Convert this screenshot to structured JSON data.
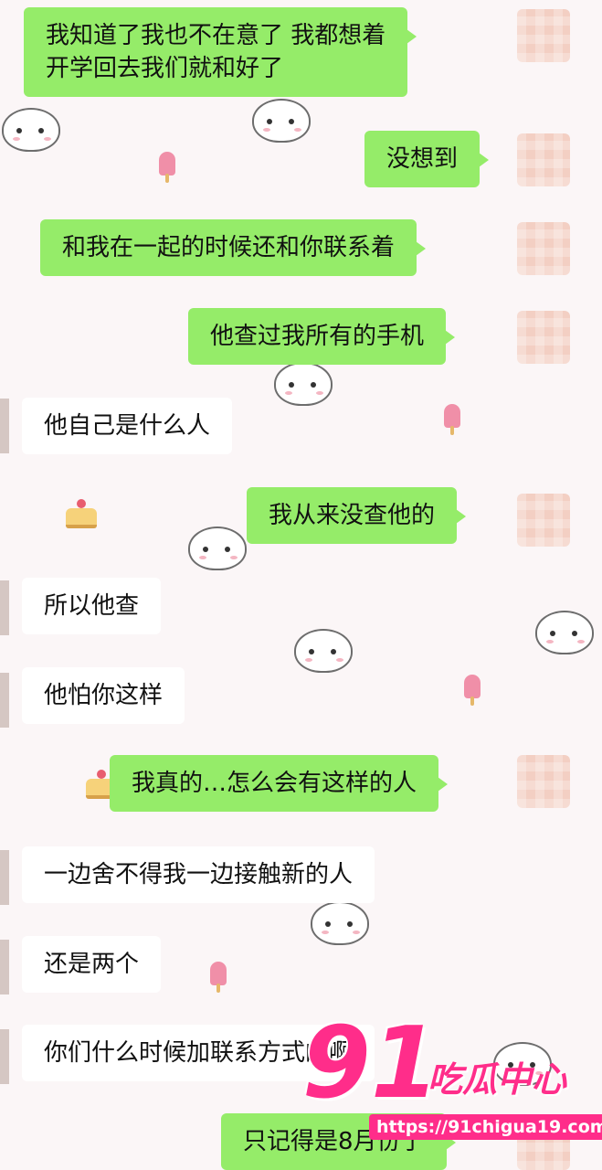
{
  "messages": [
    {
      "side": "out",
      "lines": [
        "我知道了我也不在意了 我都想着",
        "开学回去我们就和好了"
      ]
    },
    {
      "side": "out",
      "lines": [
        "没想到"
      ]
    },
    {
      "side": "out",
      "lines": [
        "和我在一起的时候还和你联系着"
      ]
    },
    {
      "side": "out",
      "lines": [
        "他查过我所有的手机"
      ]
    },
    {
      "side": "in",
      "lines": [
        "他自己是什么人"
      ]
    },
    {
      "side": "out",
      "lines": [
        "我从来没查他的"
      ]
    },
    {
      "side": "in",
      "lines": [
        "所以他查"
      ]
    },
    {
      "side": "in",
      "lines": [
        "他怕你这样"
      ]
    },
    {
      "side": "out",
      "lines": [
        "我真的…怎么会有这样的人"
      ]
    },
    {
      "side": "in",
      "lines": [
        "一边舍不得我一边接触新的人"
      ]
    },
    {
      "side": "in",
      "lines": [
        "还是两个"
      ]
    },
    {
      "side": "in",
      "lines": [
        "你们什么时候加联系方式的啊"
      ]
    },
    {
      "side": "out",
      "lines": [
        "只记得是8月份了"
      ]
    }
  ],
  "watermark": {
    "number": "91",
    "title": "吃瓜中心",
    "url": "https://91chigua19.com",
    "color": "#ff2d8a"
  },
  "colors": {
    "outgoing_bubble": "#95ec69",
    "incoming_bubble": "#ffffff",
    "background": "#fbf6f7"
  }
}
